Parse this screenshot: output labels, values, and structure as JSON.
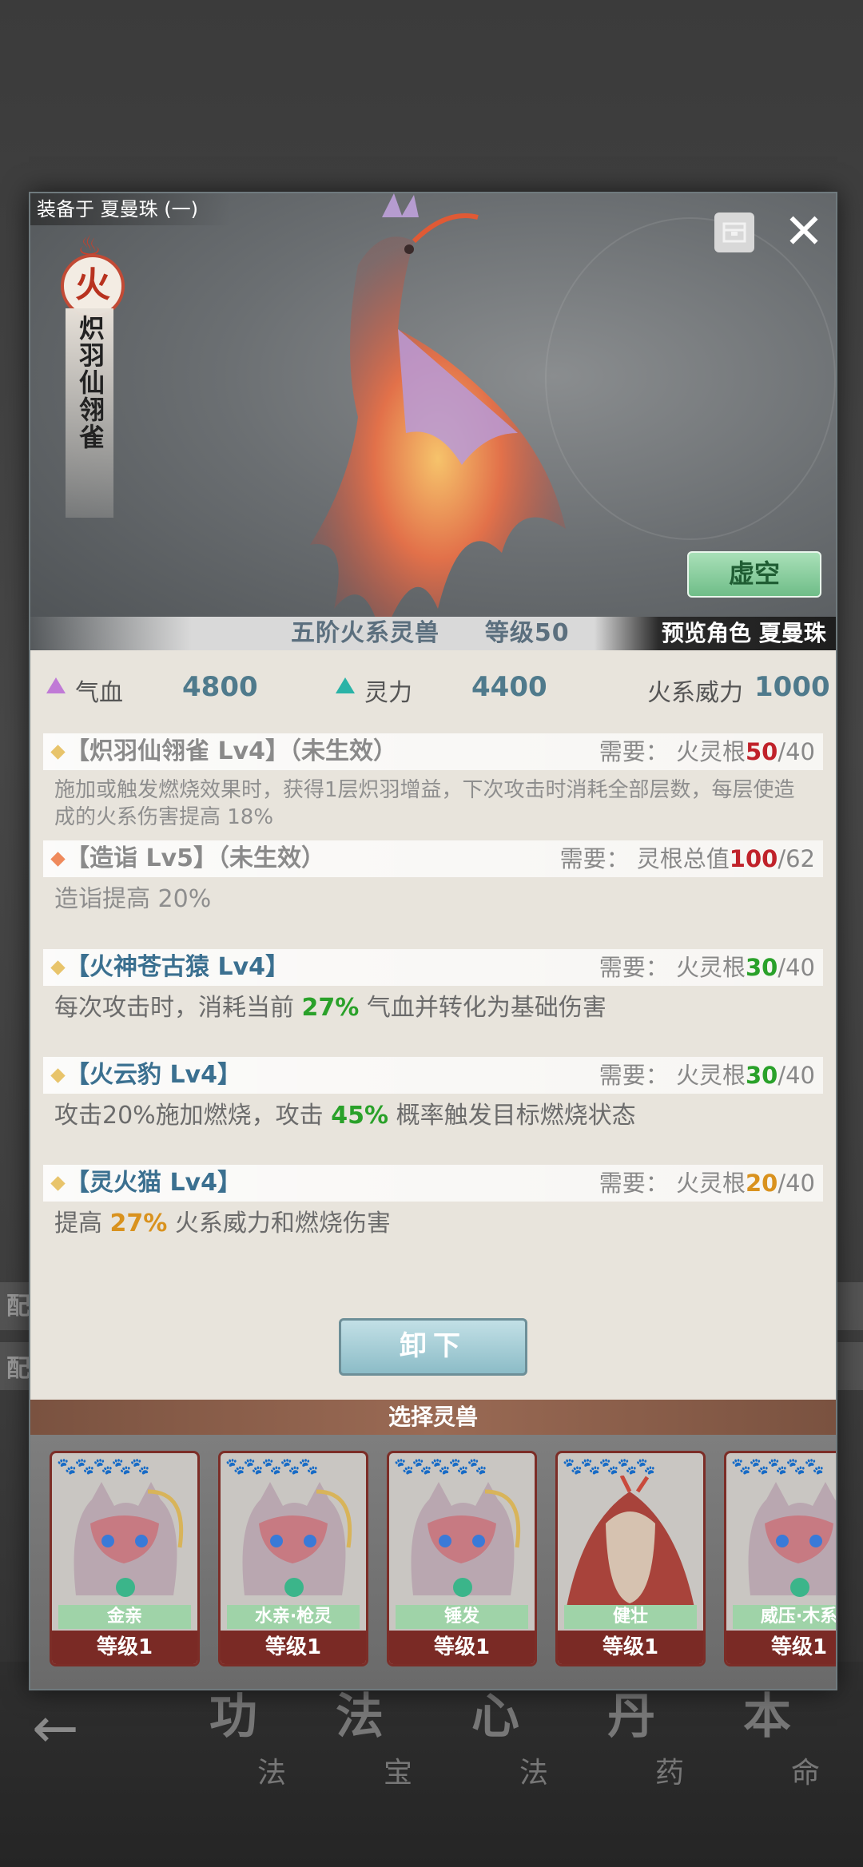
{
  "background": {
    "side_labels": [
      "配",
      "配"
    ],
    "nav": [
      {
        "big": "功",
        "small": "法"
      },
      {
        "big": "法",
        "small": "宝"
      },
      {
        "big": "心",
        "small": "法"
      },
      {
        "big": "丹",
        "small": "药"
      },
      {
        "big": "本",
        "small": "命"
      }
    ]
  },
  "modal": {
    "equip_label": "装备于 夏曼珠 (一)",
    "element_char": "火",
    "beast_name": "炽羽仙翎雀",
    "void_button": "虚空",
    "beast_tier": "五阶火系灵兽",
    "level_label": "等级50",
    "preview_role": "预览角色 夏曼珠"
  },
  "stats": {
    "hp_label": "气血",
    "hp_value": "4800",
    "sp_label": "灵力",
    "sp_value": "4400",
    "fire_label": "火系威力",
    "fire_value": "1000"
  },
  "skills": [
    {
      "title": "【炽羽仙翎雀 Lv4】（未生效）",
      "req_prefix": "需要：  火灵根",
      "req_cur": "50",
      "req_max": "/40",
      "desc": "施加或触发燃烧效果时，获得1层炽羽增益，下次攻击时消耗全部层数，每层使造成的火系伤害提高 18%"
    },
    {
      "title": "【造诣 Lv5】（未生效）",
      "req_prefix": "需要：  灵根总值",
      "req_cur": "100",
      "req_max": "/62",
      "desc": "造诣提高 20%"
    },
    {
      "title": "【火神苍古猿 Lv4】",
      "req_prefix": "需要：  火灵根",
      "req_cur": "30",
      "req_max": "/40",
      "desc_a": "每次攻击时，消耗当前 ",
      "desc_hl": "27%",
      "desc_b": " 气血并转化为基础伤害"
    },
    {
      "title": "【火云豹 Lv4】",
      "req_prefix": "需要：  火灵根",
      "req_cur": "30",
      "req_max": "/40",
      "desc_a": "攻击20%施加燃烧，攻击 ",
      "desc_hl": "45%",
      "desc_b": " 概率触发目标燃烧状态"
    },
    {
      "title": "【灵火猫 Lv4】",
      "req_prefix": "需要：  火灵根",
      "req_cur": "20",
      "req_max": "/40",
      "desc_a": "提高 ",
      "desc_hl": "27%",
      "desc_b": " 火系威力和燃烧伤害"
    }
  ],
  "unequip_button": "卸下",
  "select_header": "选择灵兽",
  "cards": [
    {
      "skill": "金亲",
      "level": "等级1"
    },
    {
      "skill": "水亲·枪灵",
      "level": "等级1"
    },
    {
      "skill": "锤发",
      "level": "等级1"
    },
    {
      "skill": "健壮",
      "level": "等级1"
    },
    {
      "skill": "威压·木系",
      "level": "等级1"
    }
  ],
  "colors": {
    "accent_green": "#2aa12a",
    "accent_orange": "#d9921e",
    "accent_red": "#c0222a",
    "stat_value": "#4f7a8c"
  }
}
